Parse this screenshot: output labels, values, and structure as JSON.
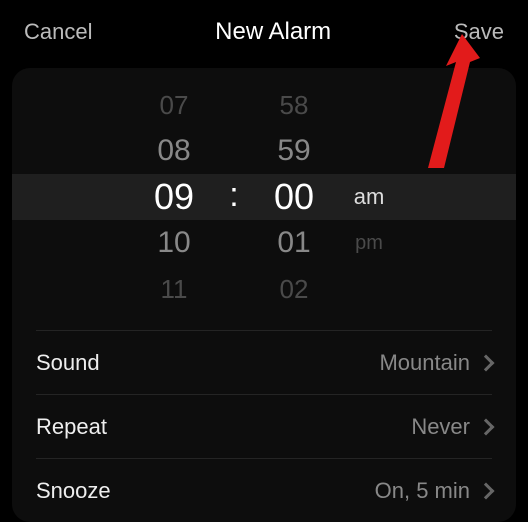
{
  "header": {
    "cancel": "Cancel",
    "title": "New Alarm",
    "save": "Save"
  },
  "picker": {
    "hours": [
      "07",
      "08",
      "09",
      "10",
      "11"
    ],
    "minutes": [
      "58",
      "59",
      "00",
      "01",
      "02"
    ],
    "colon": ":",
    "ampm": [
      "am",
      "pm"
    ],
    "selected_hour": "09",
    "selected_minute": "00",
    "selected_ampm": "am"
  },
  "settings": {
    "sound": {
      "label": "Sound",
      "value": "Mountain"
    },
    "repeat": {
      "label": "Repeat",
      "value": "Never"
    },
    "snooze": {
      "label": "Snooze",
      "value": "On, 5 min"
    }
  }
}
